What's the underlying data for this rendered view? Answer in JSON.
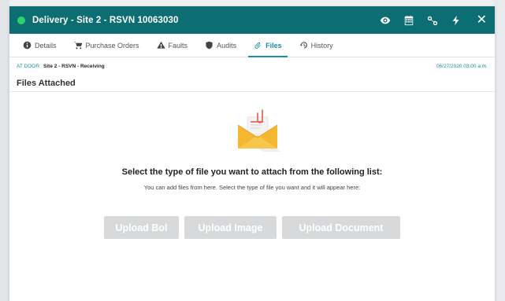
{
  "window": {
    "title": "Delivery - Site 2 - RSVN 10063030",
    "status_color": "#2bd46b",
    "header_color": "#0c6e73",
    "actions": [
      {
        "icon": "eye-icon"
      },
      {
        "icon": "calendar-icon"
      },
      {
        "icon": "link-icon"
      },
      {
        "icon": "bolt-icon"
      }
    ],
    "close_label": "✕"
  },
  "tabs": [
    {
      "label": "Details",
      "icon": "info-icon",
      "active": false
    },
    {
      "label": "Purchase Orders",
      "icon": "cart-icon",
      "active": false
    },
    {
      "label": "Faults",
      "icon": "warning-icon",
      "active": false
    },
    {
      "label": "Audits",
      "icon": "shield-icon",
      "active": false
    },
    {
      "label": "Files",
      "icon": "paperclip-icon",
      "active": true
    },
    {
      "label": "History",
      "icon": "history-icon",
      "active": false
    }
  ],
  "breadcrumb": {
    "link": "AT DOOR",
    "current": "Site 2 - RSVN - Receiving",
    "timestamp": "06/27/2020 03:00 a.m."
  },
  "section_title": "Files Attached",
  "empty_state": {
    "icon": "envelope-paperclip-icon",
    "heading": "Select the type of file you want to attach from the following list:",
    "subtext": "You can add files from here. Select the type of file you want and it will appear here:"
  },
  "buttons": {
    "upload_bol": "Upload Bol",
    "upload_image": "Upload Image",
    "upload_document": "Upload Document"
  }
}
